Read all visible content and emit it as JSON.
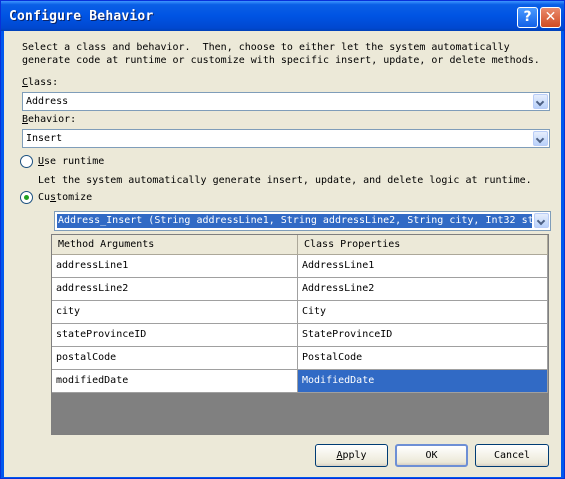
{
  "window": {
    "title": "Configure Behavior"
  },
  "description": "Select a class and behavior.  Then, choose to either let the system automatically\ngenerate code at runtime or customize with specific insert, update, or delete methods.",
  "class": {
    "label_hot": "C",
    "label_rest": "lass:",
    "value": "Address"
  },
  "behavior": {
    "label_hot": "B",
    "label_rest": "ehavior:",
    "value": "Insert"
  },
  "use_runtime": {
    "label_hot": "U",
    "label_rest": "se runtime",
    "selected": false,
    "description": "Let the system automatically generate insert, update, and delete logic at runtime."
  },
  "customize": {
    "label_pre": "Cu",
    "label_hot": "s",
    "label_rest": "tomize",
    "selected": true
  },
  "method_combo": {
    "value": "Address_Insert (String addressLine1, String addressLine2, String city, Int32 st"
  },
  "grid": {
    "headers": [
      "Method Arguments",
      "Class Properties"
    ],
    "rows": [
      {
        "arg": "addressLine1",
        "prop": "AddressLine1"
      },
      {
        "arg": "addressLine2",
        "prop": "AddressLine2"
      },
      {
        "arg": "city",
        "prop": "City"
      },
      {
        "arg": "stateProvinceID",
        "prop": "StateProvinceID"
      },
      {
        "arg": "postalCode",
        "prop": "PostalCode"
      },
      {
        "arg": "modifiedDate",
        "prop": "ModifiedDate"
      }
    ]
  },
  "buttons": {
    "apply_hot": "A",
    "apply_rest": "pply",
    "ok": "OK",
    "cancel": "Cancel"
  },
  "icons": {
    "help": "help-icon",
    "close": "close-icon",
    "dropdown": "chevron-down-icon"
  },
  "colors": {
    "titlebar": "#0054e3",
    "selection": "#316ac5",
    "dialog_bg": "#ece9d8"
  }
}
